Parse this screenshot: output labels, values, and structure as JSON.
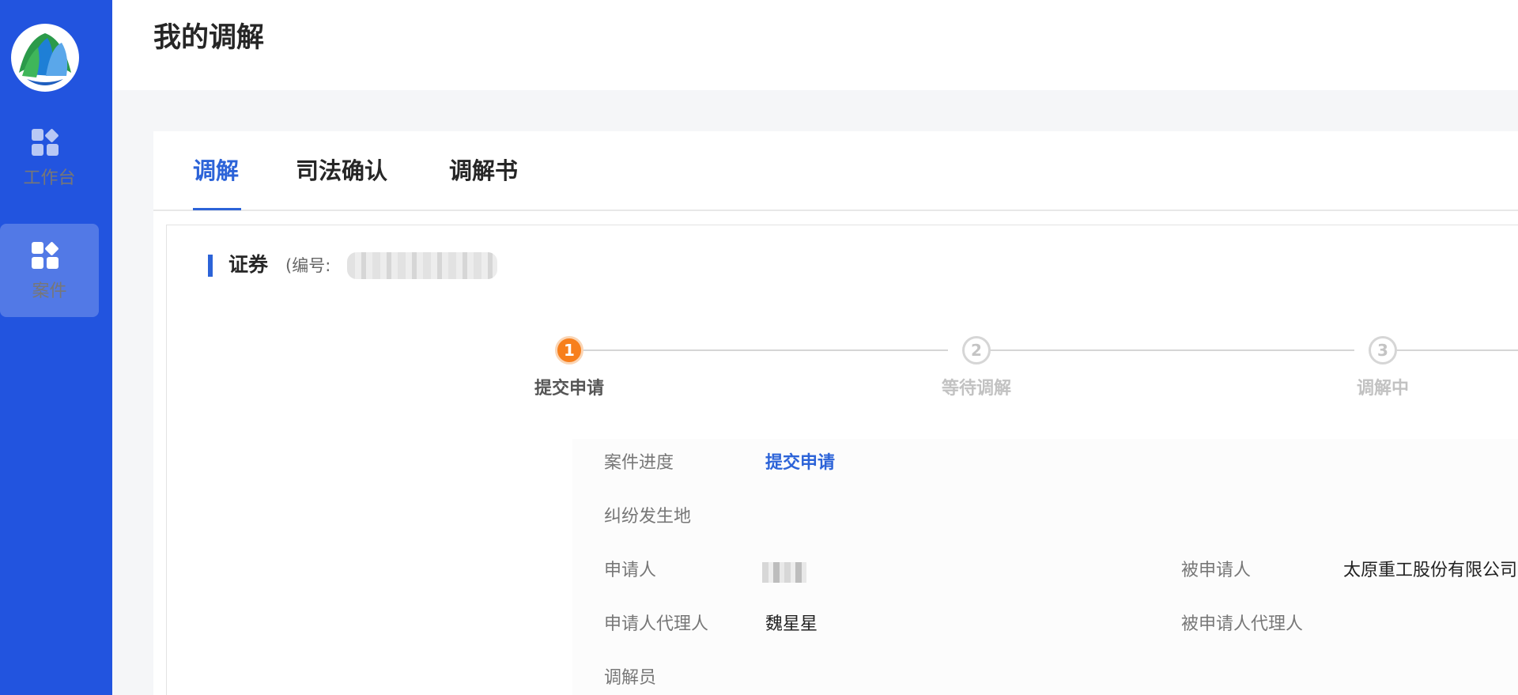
{
  "sidebar": {
    "items": [
      {
        "label": "工作台",
        "icon": "grid-icon",
        "active": false
      },
      {
        "label": "案件",
        "icon": "grid-icon",
        "active": true
      }
    ]
  },
  "header": {
    "title": "我的调解"
  },
  "tabs": [
    {
      "label": "调解",
      "active": true
    },
    {
      "label": "司法确认",
      "active": false
    },
    {
      "label": "调解书",
      "active": false
    }
  ],
  "case": {
    "type": "证券",
    "number_label": "(编号:"
  },
  "steps": [
    {
      "number": "1",
      "label": "提交申请",
      "status": "current"
    },
    {
      "number": "2",
      "label": "等待调解",
      "status": "pending"
    },
    {
      "number": "3",
      "label": "调解中",
      "status": "pending"
    }
  ],
  "details": {
    "progress_label": "案件进度",
    "progress_value": "提交申请",
    "location_label": "纠纷发生地",
    "applicant_label": "申请人",
    "respondent_label": "被申请人",
    "respondent_value": "太原重工股份有限公司",
    "applicant_agent_label": "申请人代理人",
    "applicant_agent_value": "魏星星",
    "respondent_agent_label": "被申请人代理人",
    "mediator_label": "调解员"
  },
  "colors": {
    "sidebar": "#2254df",
    "accent": "#2c63d8",
    "current_step": "#f77f1c"
  }
}
